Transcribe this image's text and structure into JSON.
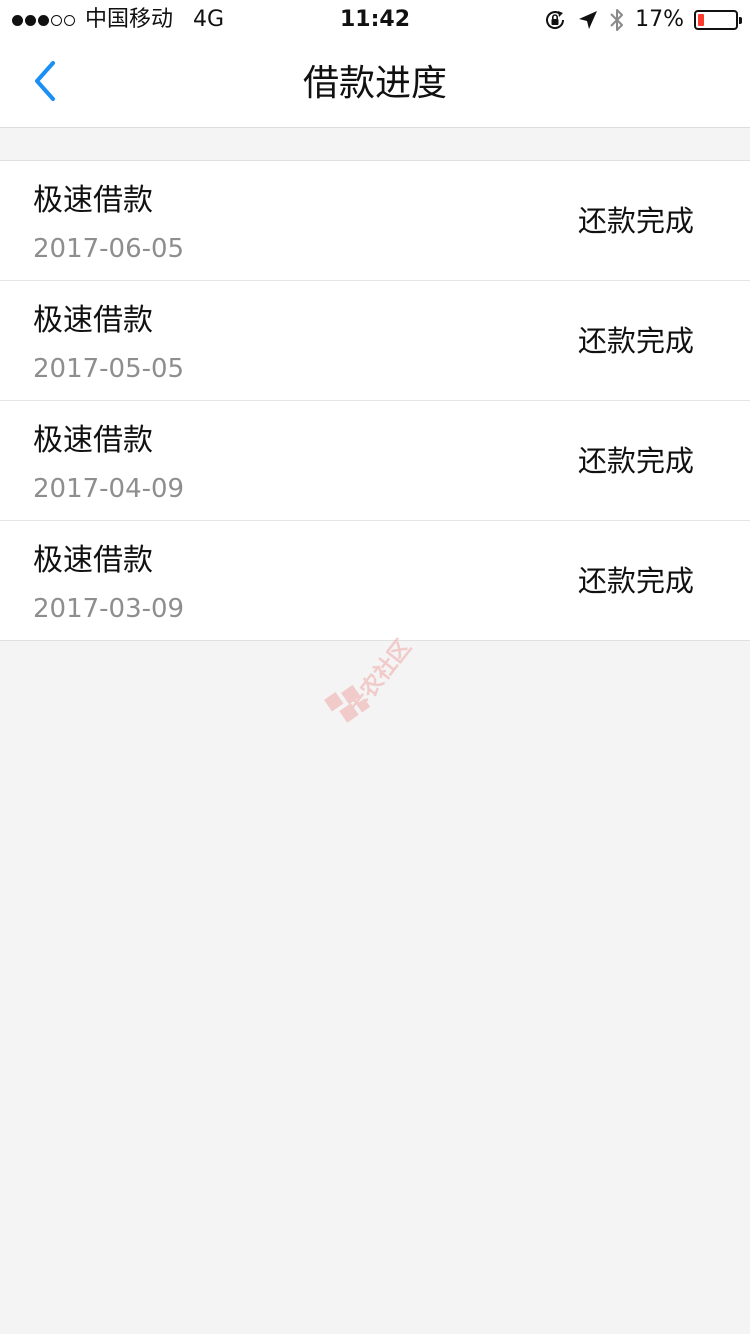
{
  "status_bar": {
    "carrier": "中国移动",
    "network": "4G",
    "time": "11:42",
    "battery_percent_text": "17%",
    "battery_level": 0.17,
    "signal_bars_filled": 3,
    "signal_bars_total": 5,
    "icons": [
      "orientation-lock-icon",
      "location-arrow-icon",
      "bluetooth-icon"
    ]
  },
  "nav": {
    "title": "借款进度",
    "back_icon": "chevron-left-icon",
    "accent_color": "#1a8ff5"
  },
  "loans": [
    {
      "name": "极速借款",
      "date": "2017-06-05",
      "status": "还款完成"
    },
    {
      "name": "极速借款",
      "date": "2017-05-05",
      "status": "还款完成"
    },
    {
      "name": "极速借款",
      "date": "2017-04-09",
      "status": "还款完成"
    },
    {
      "name": "极速借款",
      "date": "2017-03-09",
      "status": "还款完成"
    }
  ],
  "watermark": {
    "text": "卡农社区",
    "color": "#f0a8a8"
  }
}
